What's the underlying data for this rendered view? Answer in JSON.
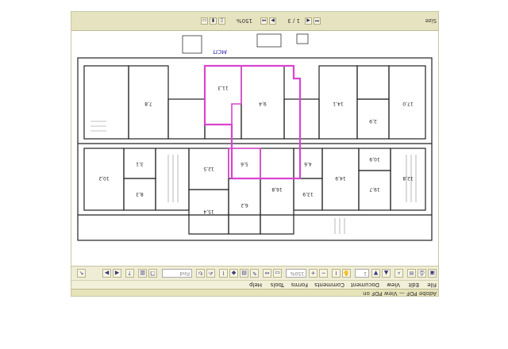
{
  "window": {
    "title": "Adobe PDF — View PDF on"
  },
  "menu": {
    "items": [
      "File",
      "Edit",
      "View",
      "Document",
      "Comments",
      "Forms",
      "Tools",
      "Help"
    ]
  },
  "toolbar": {
    "page_value": "1",
    "zoom_value": "150%",
    "page_count": "1 / 3",
    "find_placeholder": "Find"
  },
  "statusbar": {
    "zoom": "150%",
    "page": "1 / 3",
    "size": "Size"
  },
  "annotation": {
    "handwritten": "мсп"
  },
  "rooms": [
    {
      "label": "12,8"
    },
    {
      "label": "19,7"
    },
    {
      "label": "10,9"
    },
    {
      "label": "14,9"
    },
    {
      "label": "13,9"
    },
    {
      "label": "16,8"
    },
    {
      "label": "6,2"
    },
    {
      "label": "15,4"
    },
    {
      "label": "5,6"
    },
    {
      "label": "12,5"
    },
    {
      "label": "8,3"
    },
    {
      "label": "10,2"
    },
    {
      "label": "4,6"
    },
    {
      "label": "3,1"
    },
    {
      "label": "17,0"
    },
    {
      "label": "14,1"
    },
    {
      "label": "9,4"
    },
    {
      "label": "11,3"
    },
    {
      "label": "7,8"
    },
    {
      "label": "2,9"
    }
  ],
  "colors": {
    "highlight": "#d844d0",
    "titlebar": "#e6e3b8",
    "frame": "#c9c6a8"
  }
}
